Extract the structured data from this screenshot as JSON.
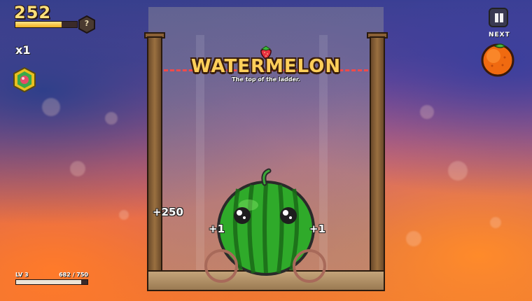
{
  "hud": {
    "score": "252",
    "score_progress": 0.75,
    "help_glyph": "?",
    "multiplier": "x1",
    "powerup_icon": "fruit-hex-badge-icon",
    "level_label": "LV 3",
    "xp_text": "682 / 750",
    "xp_progress": 0.909
  },
  "next": {
    "label": "NEXT",
    "fruit_icon": "orange-icon"
  },
  "jar": {
    "goal_title": "WATERMELON",
    "goal_subtitle": "The top of the ladder.",
    "goal_icon": "strawberry-icon",
    "current_fruit_icon": "watermelon-icon"
  },
  "popups": {
    "left_score": "+250",
    "left_bonus": "+1",
    "right_bonus": "+1"
  },
  "colors": {
    "score_yellow": "#ffe07a",
    "title_gold": "#ffcf5a",
    "limit_line_red": "#f04a4a",
    "watermelon_green": "#2faa2a"
  }
}
